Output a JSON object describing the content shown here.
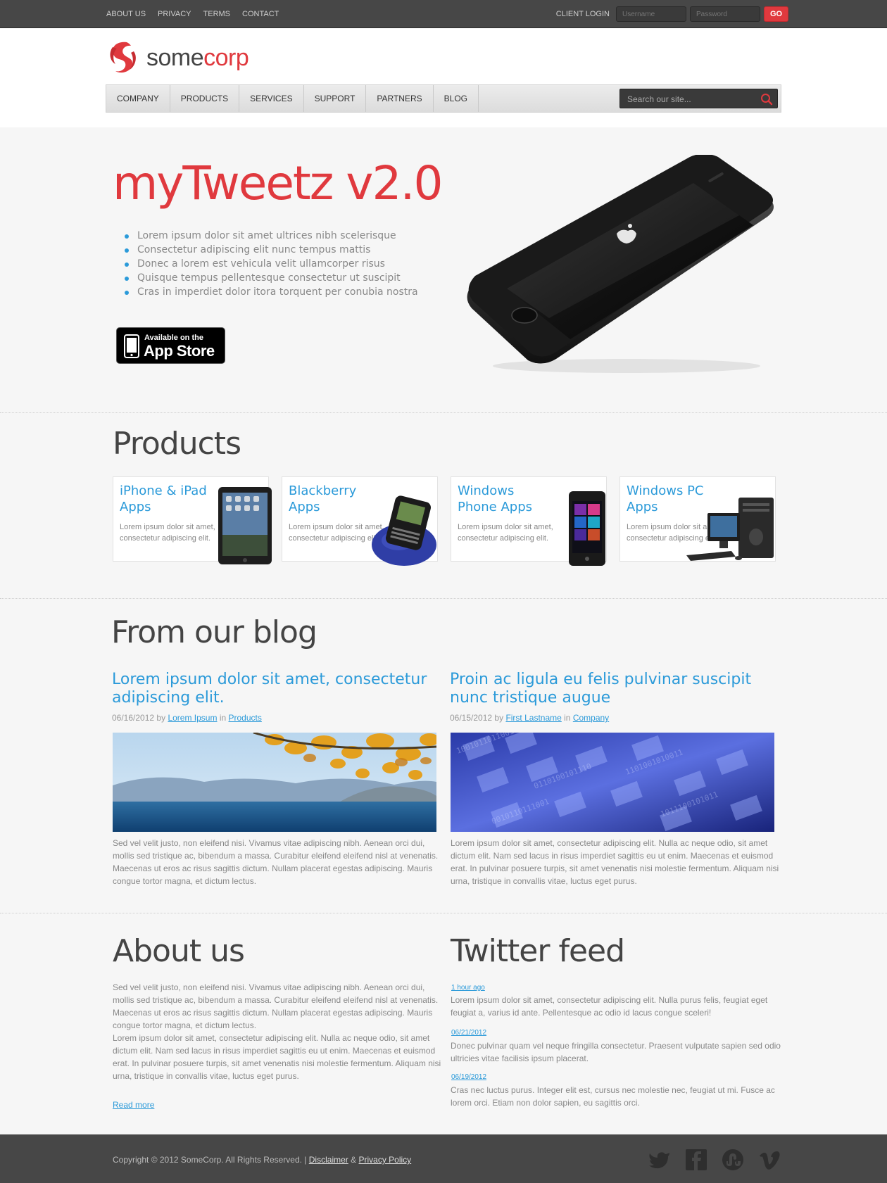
{
  "topbar": {
    "links": [
      "ABOUT US",
      "PRIVACY",
      "TERMS",
      "CONTACT"
    ],
    "client_login_label": "CLIENT LOGIN",
    "username_placeholder": "Username",
    "password_placeholder": "Password",
    "go_label": "GO"
  },
  "logo": {
    "some": "some",
    "corp": "corp"
  },
  "nav": {
    "items": [
      "COMPANY",
      "PRODUCTS",
      "SERVICES",
      "SUPPORT",
      "PARTNERS",
      "BLOG"
    ],
    "search_placeholder": "Search our site..."
  },
  "hero": {
    "title": "myTweetz v2.0",
    "bullets": [
      "Lorem ipsum dolor sit amet ultrices nibh scelerisque",
      "Consectetur adipiscing elit nunc tempus mattis",
      "Donec a lorem est vehicula velit ullamcorper risus",
      "Quisque tempus pellentesque consectetur ut suscipit",
      "Cras in imperdiet dolor itora torquent per conubia nostra"
    ],
    "appstore_small": "Available on the",
    "appstore_big": "App Store"
  },
  "products": {
    "heading": "Products",
    "items": [
      {
        "title": "iPhone & iPad Apps",
        "desc": "Lorem ipsum dolor sit amet, consectetur adipiscing elit."
      },
      {
        "title": "Blackberry Apps",
        "desc": "Lorem ipsum dolor sit amet, consectetur adipiscing elit."
      },
      {
        "title": "Windows Phone Apps",
        "desc": "Lorem ipsum dolor sit amet, consectetur adipiscing elit."
      },
      {
        "title": "Windows PC Apps",
        "desc": "Lorem ipsum dolor sit amet, consectetur adipiscing elit."
      }
    ]
  },
  "blog": {
    "heading": "From our blog",
    "posts": [
      {
        "title": "Lorem ipsum dolor sit amet, consectetur adipiscing elit.",
        "date": "06/16/2012",
        "by": "by",
        "author": "Lorem Ipsum",
        "in": "in",
        "category": "Products",
        "text": "Sed vel velit justo, non eleifend nisi. Vivamus vitae adipiscing nibh. Aenean orci dui, mollis sed tristique ac, bibendum a massa. Curabitur eleifend eleifend nisl at venenatis. Maecenas ut eros ac risus sagittis dictum. Nullam placerat egestas adipiscing. Mauris congue tortor magna, et dictum lectus."
      },
      {
        "title": "Proin ac ligula eu felis pulvinar suscipit nunc tristique augue",
        "date": "06/15/2012",
        "by": "by",
        "author": "First Lastname",
        "in": "in",
        "category": "Company",
        "text": "Lorem ipsum dolor sit amet, consectetur adipiscing elit. Nulla ac neque odio, sit amet dictum elit. Nam sed lacus in risus imperdiet sagittis eu ut enim. Maecenas et euismod erat. In pulvinar posuere turpis, sit amet venenatis nisi molestie fermentum. Aliquam nisi urna, tristique in convallis vitae, luctus eget purus."
      }
    ]
  },
  "about": {
    "heading": "About us",
    "p1": "Sed vel velit justo, non eleifend nisi. Vivamus vitae adipiscing nibh. Aenean orci dui, mollis sed tristique ac, bibendum a massa. Curabitur eleifend eleifend nisl at venenatis. Maecenas ut eros ac risus sagittis dictum. Nullam placerat egestas adipiscing. Mauris congue tortor magna, et dictum lectus.",
    "p2": "Lorem ipsum dolor sit amet, consectetur adipiscing elit. Nulla ac neque odio, sit amet dictum elit. Nam sed lacus in risus imperdiet sagittis eu ut enim. Maecenas et euismod erat. In pulvinar posuere turpis, sit amet venenatis nisi molestie fermentum. Aliquam nisi urna, tristique in convallis vitae, luctus eget purus.",
    "read_more": "Read more"
  },
  "twitter": {
    "heading": "Twitter feed",
    "tweets": [
      {
        "date": "1 hour ago",
        "text": "Lorem ipsum dolor sit amet, consectetur adipiscing elit. Nulla purus felis, feugiat eget feugiat a, varius id ante. Pellentesque ac odio id lacus congue sceleri!"
      },
      {
        "date": "06/21/2012",
        "text": "Donec pulvinar quam vel neque fringilla consectetur. Praesent vulputate sapien sed odio ultricies vitae facilisis ipsum placerat."
      },
      {
        "date": "06/19/2012",
        "text": "Cras nec luctus purus. Integer elit est, cursus nec molestie nec, feugiat ut mi. Fusce ac lorem orci. Etiam non dolor sapien, eu sagittis orci."
      }
    ]
  },
  "footer": {
    "copyright": "Copyright © 2012 SomeCorp. All Rights Reserved. |",
    "disclaimer": "Disclaimer",
    "amp": "&",
    "privacy": "Privacy Policy",
    "social_icons": [
      "twitter-icon",
      "facebook-icon",
      "stumbleupon-icon",
      "vimeo-icon"
    ]
  },
  "colors": {
    "accent_red": "#e0393e",
    "link_blue": "#2b9ad9",
    "dark_bar": "#474747"
  }
}
